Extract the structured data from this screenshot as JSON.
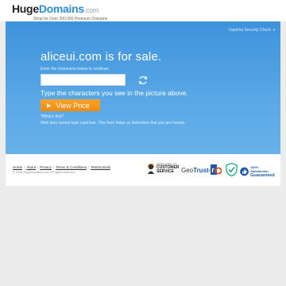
{
  "header": {
    "logo_huge": "Huge",
    "logo_domains": "Domains",
    "logo_com": ".com",
    "tagline": "Shop for Over 200,000 Premium Domains"
  },
  "panel": {
    "captcha_link": "Captcha Security Check",
    "headline": "aliceui.com is for sale.",
    "enter_label": "Enter the characters below to continue:",
    "input_value": "",
    "input_placeholder": "",
    "type_text": "Type the characters you see in the picture above.",
    "view_price_label": "View Price",
    "whats_this": "*What's this?",
    "bot_note": "Web bots cannot type captchas. This form helps us determine that you are human."
  },
  "footer": {
    "links": [
      "Home",
      "About",
      "Privacy",
      "Terms & Conditions",
      "Testimonials"
    ],
    "copyright": "© 2016 HugeDomains.com. All rights reserved.",
    "badges": {
      "dedicated_small": "DEDICATED TO",
      "dedicated_big1": "CUSTOMER",
      "dedicated_big2": "SERVICE",
      "geotrust_geo": "Geo",
      "geotrust_trust": "Trust",
      "satisfaction_small": "100% Satisfaction",
      "satisfaction_big": "Guaranteed"
    }
  },
  "colors": {
    "panel_top": "#3d93db",
    "panel_bottom": "#68b1ea",
    "button": "#f6931a",
    "brand_blue": "#2a8fd6"
  },
  "icons": [
    "refresh-icon",
    "play-icon",
    "headset-icon",
    "rq-icon",
    "shield-icon",
    "thumbs-up-icon"
  ]
}
